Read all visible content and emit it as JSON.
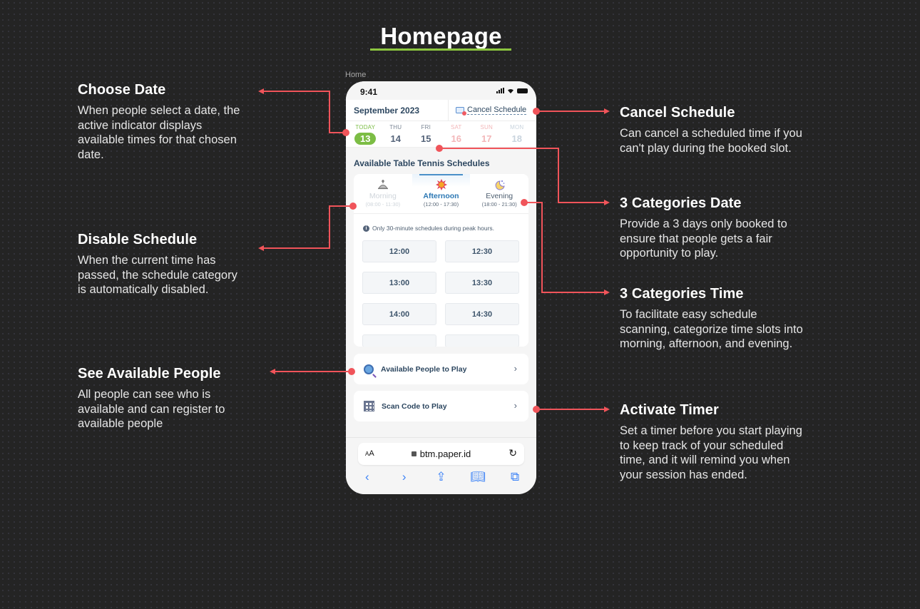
{
  "page": {
    "title": "Homepage",
    "frame_label": "Home",
    "accent_color": "#8cc63f",
    "connector_color": "#f0545a"
  },
  "notes": {
    "choose_date": {
      "title": "Choose Date",
      "body": "When people select a date, the active indicator displays available times for that chosen date."
    },
    "disable_schedule": {
      "title": "Disable Schedule",
      "body": "When the current time has passed, the schedule category is automatically disabled."
    },
    "see_people": {
      "title": "See Available People",
      "body": "All people can see who is available and can register to available people"
    },
    "cancel_schedule": {
      "title": "Cancel Schedule",
      "body": "Can cancel a scheduled time if you can't play during the booked slot."
    },
    "categories_date": {
      "title": "3 Categories Date",
      "body": "Provide a 3 days only booked to ensure that people gets a fair opportunity to play."
    },
    "categories_time": {
      "title": "3 Categories Time",
      "body": "To facilitate easy schedule scanning, categorize time slots into morning, afternoon, and evening."
    },
    "activate_timer": {
      "title": "Activate Timer",
      "body": "Set a timer before you start playing to keep track of your scheduled time, and it will remind you when your session has ended."
    }
  },
  "phone": {
    "status_time": "9:41",
    "month": "September 2023",
    "cancel_label": "Cancel Schedule",
    "days": [
      {
        "name": "TODAY",
        "num": "13",
        "state": "today"
      },
      {
        "name": "THU",
        "num": "14",
        "state": "normal"
      },
      {
        "name": "FRI",
        "num": "15",
        "state": "normal"
      },
      {
        "name": "SAT",
        "num": "16",
        "state": "weekend"
      },
      {
        "name": "SUN",
        "num": "17",
        "state": "weekend"
      },
      {
        "name": "MON",
        "num": "18",
        "state": "disabled"
      }
    ],
    "section_title": "Available Table Tennis Schedules",
    "categories": [
      {
        "name": "Morning",
        "range": "(08:00 - 11:30)",
        "icon": "morning-icon",
        "state": "disabled"
      },
      {
        "name": "Afternoon",
        "range": "(12:00 - 17:30)",
        "icon": "sun-icon",
        "state": "active"
      },
      {
        "name": "Evening",
        "range": "(18:00 - 21:30)",
        "icon": "moon-icon",
        "state": "normal"
      }
    ],
    "info_text": "Only 30-minute schedules during peak hours.",
    "slots": [
      "12:00",
      "12:30",
      "13:00",
      "13:30",
      "14:00",
      "14:30"
    ],
    "actions": [
      {
        "label": "Available People to Play",
        "icon": "people-search-icon"
      },
      {
        "label": "Scan Code to Play",
        "icon": "qr-code-icon"
      }
    ],
    "browser": {
      "aa_label": "AA",
      "url": "btm.paper.id"
    }
  }
}
